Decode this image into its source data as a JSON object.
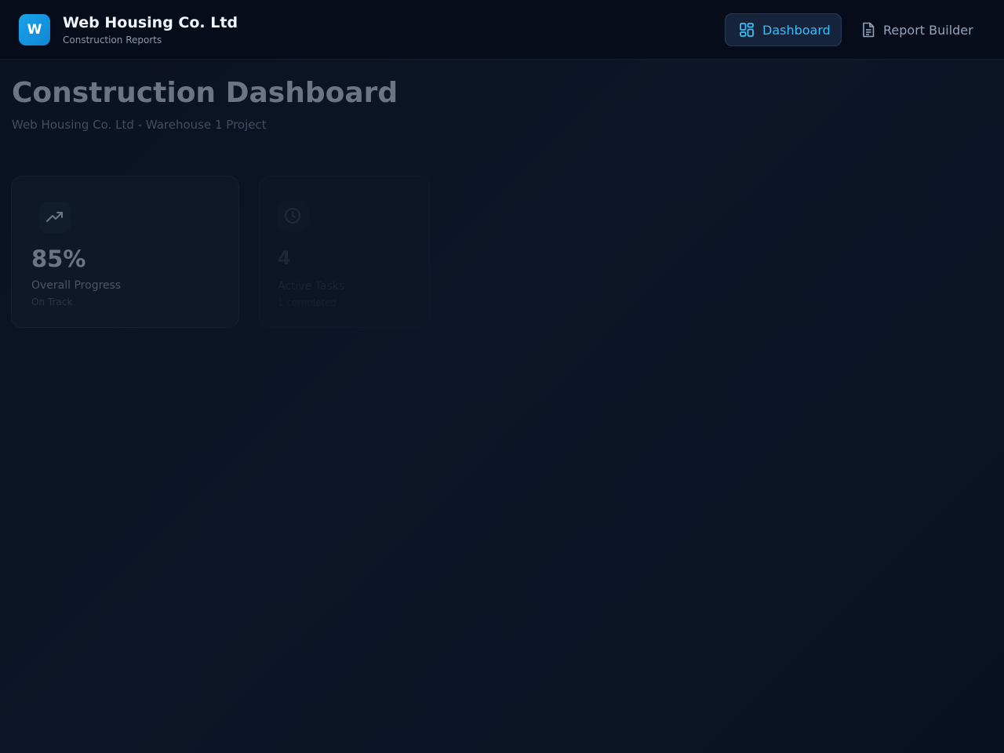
{
  "brand": {
    "logo_letter": "W",
    "name": "Web Housing Co. Ltd",
    "subtitle": "Construction Reports"
  },
  "nav": {
    "dashboard_label": "Dashboard",
    "report_builder_label": "Report Builder",
    "active": "Dashboard",
    "dashboard_icon": "grid-icon",
    "report_builder_icon": "document-icon"
  },
  "page": {
    "title": "Construction Dashboard",
    "subtitle": "Web Housing Co. Ltd - Warehouse 1 Project"
  },
  "cards": [
    {
      "icon": "trending-up-icon",
      "value": "85%",
      "label": "Overall Progress",
      "note": "On Track"
    },
    {
      "icon": "clock-icon",
      "value": "4",
      "label": "Active Tasks",
      "note": "1 completed"
    }
  ],
  "colors": {
    "accent": "#38bdf8",
    "logo": "#1aa3e8",
    "background": "#0b1120"
  }
}
